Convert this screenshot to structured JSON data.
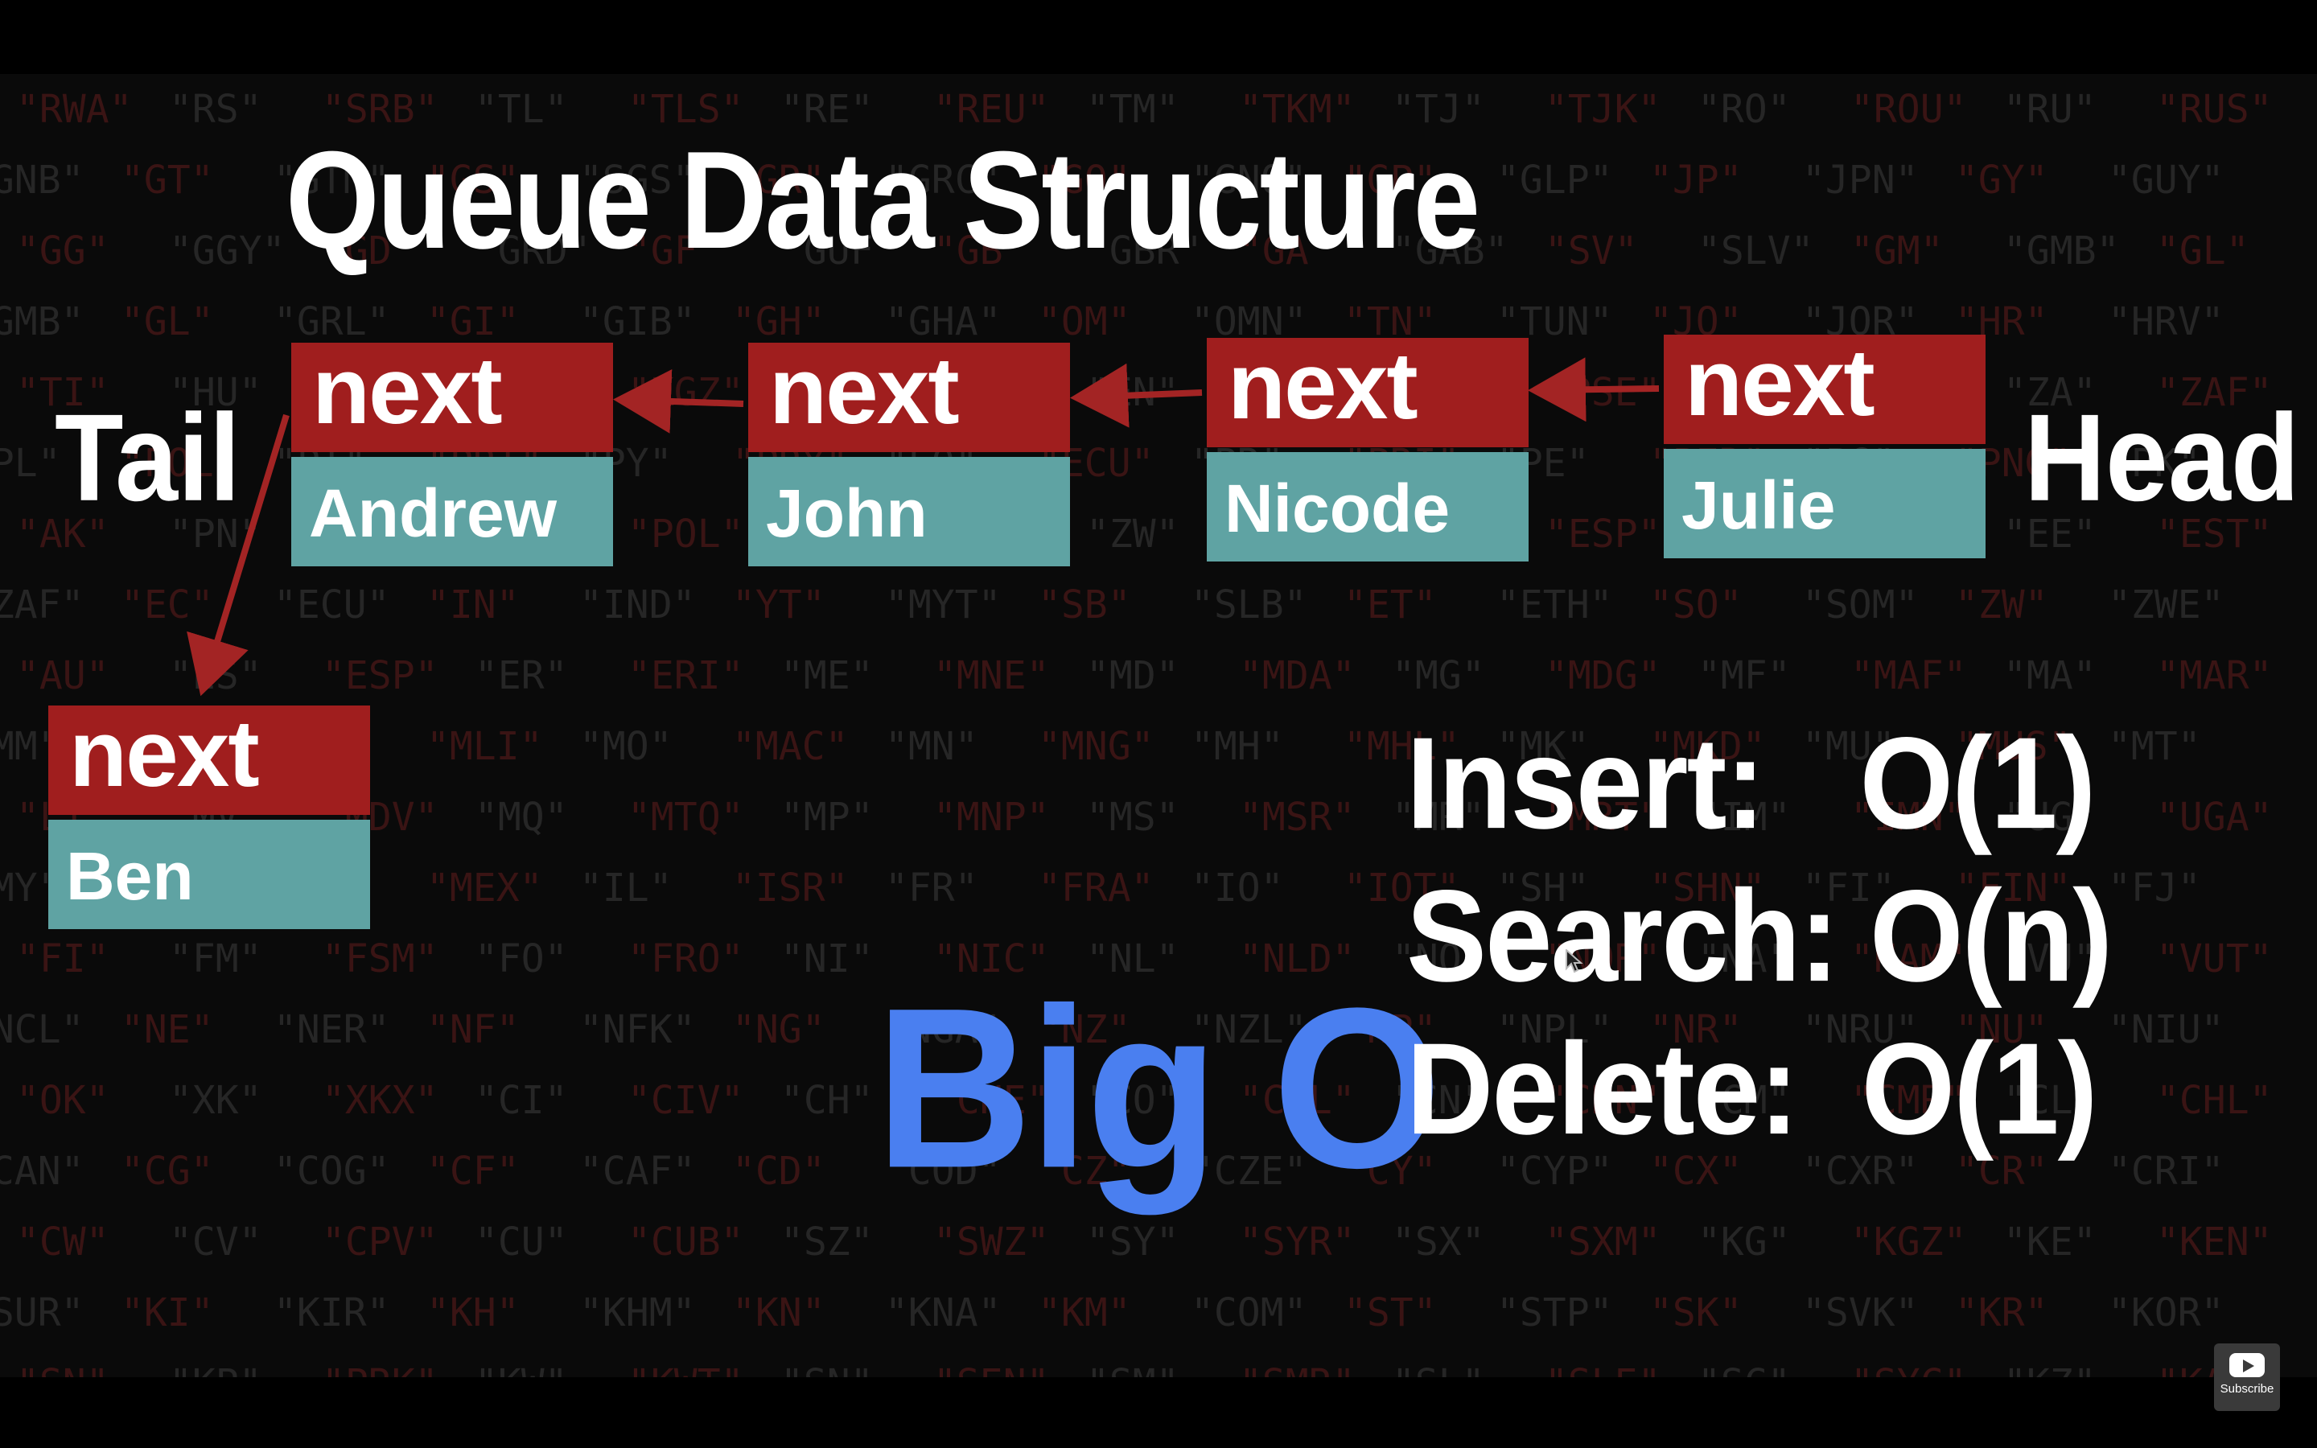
{
  "title": "Queue Data Structure",
  "labels": {
    "tail": "Tail",
    "head": "Head"
  },
  "nodes": [
    {
      "next": "next",
      "value": "Ben"
    },
    {
      "next": "next",
      "value": "Andrew"
    },
    {
      "next": "next",
      "value": "John"
    },
    {
      "next": "next",
      "value": "Nicode"
    },
    {
      "next": "next",
      "value": "Julie"
    }
  ],
  "big_o": {
    "heading": "Big O",
    "insert": "Insert:   O(1)",
    "search": "Search: O(n)",
    "delete": "Delete:  O(1)"
  },
  "subscribe": {
    "label": "Subscribe"
  },
  "background_rows": [
    [
      "\"RWA\"",
      "\"RS\"",
      "\"SRB\"",
      "\"TL\"",
      "\"TLS\"",
      "\"RE\"",
      "\"REU\"",
      "\"TM\"",
      "\"TKM\"",
      "\"TJ\"",
      "\"TJK\"",
      "\"RO\"",
      "\"ROU\"",
      "\"RU\"",
      "\"RUS\""
    ],
    [
      "\"GNB\"",
      "\"GT\"",
      "\"GTM\"",
      "\"GS\"",
      "\"SGS\"",
      "\"GR\"",
      "\"GRC\"",
      "\"GQ\"",
      "\"GNQ\"",
      "\"GP\"",
      "\"GLP\"",
      "\"JP\"",
      "\"JPN\"",
      "\"GY\"",
      "\"GUY\""
    ],
    [
      "\"GG\"",
      "\"GGY\"",
      "\"GD\"",
      "\"GRD\"",
      "\"GF\"",
      "\"GUF\"",
      "\"GB\"",
      "\"GBR\"",
      "\"GA\"",
      "\"GAB\"",
      "\"SV\"",
      "\"SLV\"",
      "\"GM\"",
      "\"GMB\"",
      "\"GL\""
    ],
    [
      "\"GMB\"",
      "\"GL\"",
      "\"GRL\"",
      "\"GI\"",
      "\"GIB\"",
      "\"GH\"",
      "\"GHA\"",
      "\"OM\"",
      "\"OMN\"",
      "\"TN\"",
      "\"TUN\"",
      "\"JO\"",
      "\"JOR\"",
      "\"HR\"",
      "\"HRV\""
    ],
    [
      "\"TI\"",
      "\"HU\"",
      "\"HUN\"",
      "\"KG\"",
      "\"KGZ\"",
      "\"HM\"",
      "\"HMD\"",
      "\"EN\"",
      "\"ENP\"",
      "\"PS\"",
      "\"PSE\"",
      "\"PN\"",
      "\"PCN\"",
      "\"ZA\"",
      "\"ZAF\""
    ],
    [
      "\"PL\"",
      "\"POL\"",
      "\"PT\"",
      "\"PRT\"",
      "\"PY\"",
      "\"PRY\"",
      "\"EQ\"",
      "\"ECU\"",
      "\"PR\"",
      "\"PRI\"",
      "\"PE\"",
      "\"PER\"",
      "\"PG\"",
      "\"PNG\"",
      "\"PK\""
    ],
    [
      "\"AK\"",
      "\"PN\"",
      "\"PCN\"",
      "\"PL\"",
      "\"POL\"",
      "\"ZM\"",
      "\"ZMB\"",
      "\"ZW\"",
      "\"ZWE\"",
      "\"ES\"",
      "\"ESP\"",
      "\"ER\"",
      "\"ERI\"",
      "\"EE\"",
      "\"EST\""
    ],
    [
      "\"ZAF\"",
      "\"EC\"",
      "\"ECU\"",
      "\"IN\"",
      "\"IND\"",
      "\"YT\"",
      "\"MYT\"",
      "\"SB\"",
      "\"SLB\"",
      "\"ET\"",
      "\"ETH\"",
      "\"SO\"",
      "\"SOM\"",
      "\"ZW\"",
      "\"ZWE\""
    ],
    [
      "\"AU\"",
      "\"ES\"",
      "\"ESP\"",
      "\"ER\"",
      "\"ERI\"",
      "\"ME\"",
      "\"MNE\"",
      "\"MD\"",
      "\"MDA\"",
      "\"MG\"",
      "\"MDG\"",
      "\"MF\"",
      "\"MAF\"",
      "\"MA\"",
      "\"MAR\""
    ],
    [
      "\"MM\"",
      "\"MMR\"",
      "\"ML\"",
      "\"MLI\"",
      "\"MO\"",
      "\"MAC\"",
      "\"MN\"",
      "\"MNG\"",
      "\"MH\"",
      "\"MHL\"",
      "\"MK\"",
      "\"MKD\"",
      "\"MU\"",
      "\"MUS\"",
      "\"MT\""
    ],
    [
      "\"LT\"",
      "\"MV\"",
      "\"MDV\"",
      "\"MQ\"",
      "\"MTQ\"",
      "\"MP\"",
      "\"MNP\"",
      "\"MS\"",
      "\"MSR\"",
      "\"MR\"",
      "\"MRT\"",
      "\"IM\"",
      "\"IMN\"",
      "\"UG\"",
      "\"UGA\""
    ],
    [
      "\"MY\"",
      "\"MYS\"",
      "\"MX\"",
      "\"MEX\"",
      "\"IL\"",
      "\"ISR\"",
      "\"FR\"",
      "\"FRA\"",
      "\"IO\"",
      "\"IOT\"",
      "\"SH\"",
      "\"SHN\"",
      "\"FI\"",
      "\"FIN\"",
      "\"FJ\""
    ],
    [
      "\"FI\"",
      "\"FM\"",
      "\"FSM\"",
      "\"FO\"",
      "\"FRO\"",
      "\"NI\"",
      "\"NIC\"",
      "\"NL\"",
      "\"NLD\"",
      "\"NO\"",
      "\"NOR\"",
      "\"NA\"",
      "\"NAM\"",
      "\"VU\"",
      "\"VUT\""
    ],
    [
      "\"NCL\"",
      "\"NE\"",
      "\"NER\"",
      "\"NF\"",
      "\"NFK\"",
      "\"NG\"",
      "\"NGA\"",
      "\"NZ\"",
      "\"NZL\"",
      "\"NP\"",
      "\"NPL\"",
      "\"NR\"",
      "\"NRU\"",
      "\"NU\"",
      "\"NIU\""
    ],
    [
      "\"OK\"",
      "\"XK\"",
      "\"XKX\"",
      "\"CI\"",
      "\"CIV\"",
      "\"CH\"",
      "\"CHE\"",
      "\"CO\"",
      "\"COL\"",
      "\"CN\"",
      "\"CHN\"",
      "\"CM\"",
      "\"CMR\"",
      "\"CL\"",
      "\"CHL\""
    ],
    [
      "\"CAN\"",
      "\"CG\"",
      "\"COG\"",
      "\"CF\"",
      "\"CAF\"",
      "\"CD\"",
      "\"COD\"",
      "\"CZ\"",
      "\"CZE\"",
      "\"CY\"",
      "\"CYP\"",
      "\"CX\"",
      "\"CXR\"",
      "\"CR\"",
      "\"CRI\""
    ],
    [
      "\"CW\"",
      "\"CV\"",
      "\"CPV\"",
      "\"CU\"",
      "\"CUB\"",
      "\"SZ\"",
      "\"SWZ\"",
      "\"SY\"",
      "\"SYR\"",
      "\"SX\"",
      "\"SXM\"",
      "\"KG\"",
      "\"KGZ\"",
      "\"KE\"",
      "\"KEN\""
    ],
    [
      "\"SUR\"",
      "\"KI\"",
      "\"KIR\"",
      "\"KH\"",
      "\"KHM\"",
      "\"KN\"",
      "\"KNA\"",
      "\"KM\"",
      "\"COM\"",
      "\"ST\"",
      "\"STP\"",
      "\"SK\"",
      "\"SVK\"",
      "\"KR\"",
      "\"KOR\""
    ],
    [
      "\"SN\"",
      "\"KP\"",
      "\"PRK\"",
      "\"KW\"",
      "\"KWT\"",
      "\"SN\"",
      "\"SEN\"",
      "\"SM\"",
      "\"SMR\"",
      "\"SL\"",
      "\"SLE\"",
      "\"SC\"",
      "\"SYC\"",
      "\"KZ\"",
      "\"KAZ\""
    ]
  ]
}
